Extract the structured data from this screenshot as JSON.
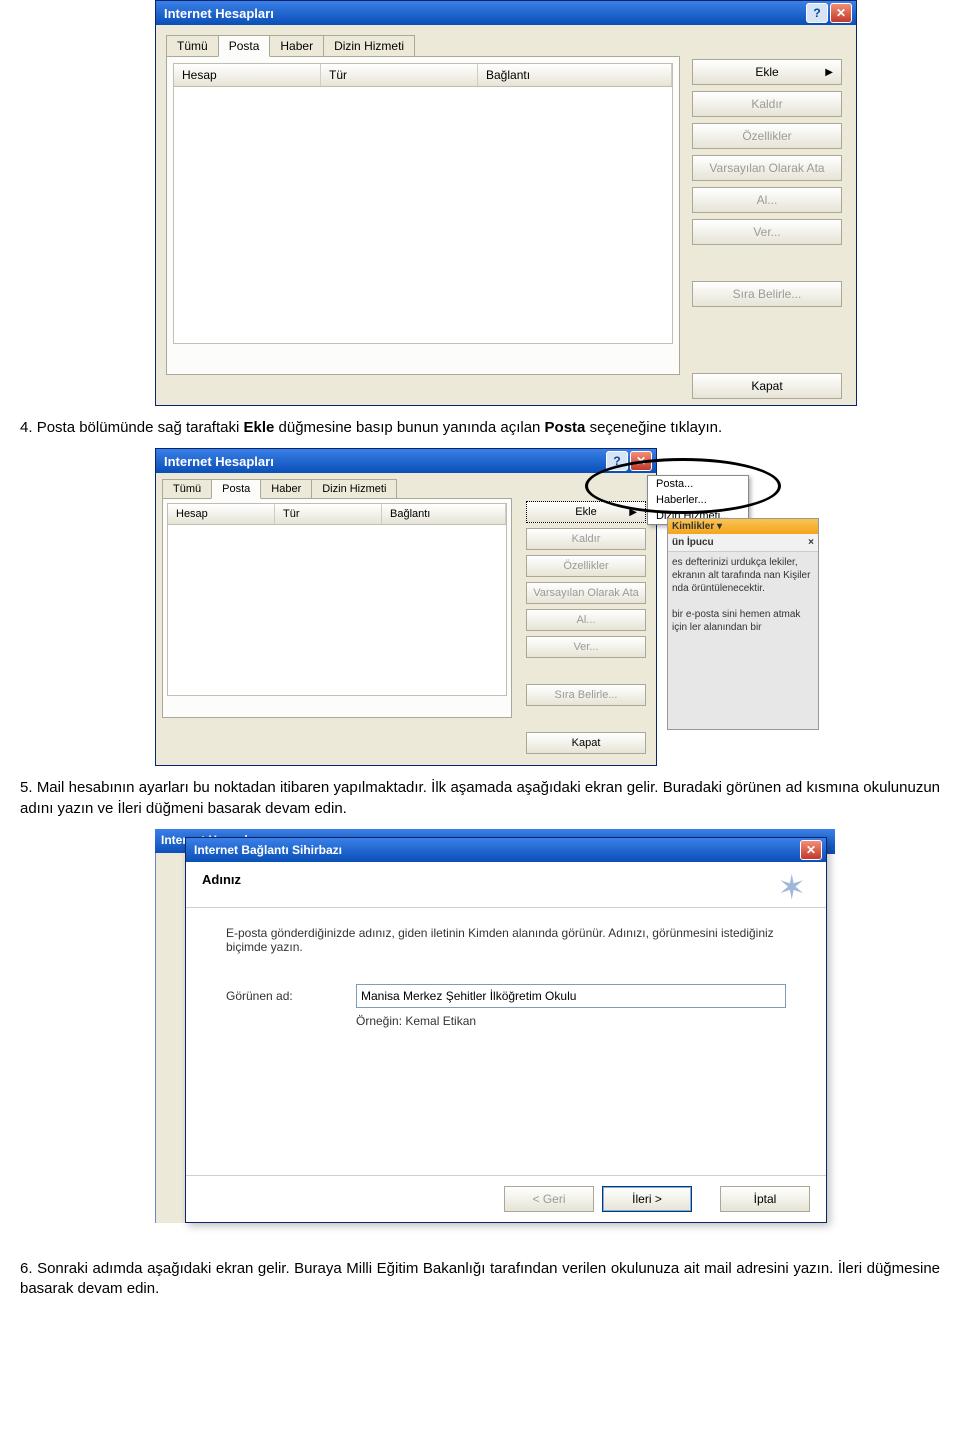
{
  "dlg1": {
    "title": "Internet Hesapları",
    "tabs": [
      "Tümü",
      "Posta",
      "Haber",
      "Dizin Hizmeti"
    ],
    "activeTab": 1,
    "columns": [
      "Hesap",
      "Tür",
      "Bağlantı"
    ],
    "buttons": {
      "ekle": "Ekle",
      "kaldir": "Kaldır",
      "ozellikler": "Özellikler",
      "varsayilan": "Varsayılan Olarak Ata",
      "al": "Al...",
      "ver": "Ver...",
      "sira": "Sıra Belirle...",
      "kapat": "Kapat"
    }
  },
  "instr4": {
    "num": "4.",
    "p1": "Posta bölümünde sağ taraftaki ",
    "b1": "Ekle",
    "p2": " düğmesine basıp bunun yanında açılan ",
    "b2": "Posta",
    "p3": " seçeneğine tıklayın."
  },
  "dlg2": {
    "title": "Internet Hesapları",
    "tabs": [
      "Tümü",
      "Posta",
      "Haber",
      "Dizin Hizmeti"
    ],
    "columns": [
      "Hesap",
      "Tür",
      "Bağlantı"
    ],
    "buttons": {
      "ekle": "Ekle",
      "kaldir": "Kaldır",
      "ozellikler": "Özellikler",
      "varsayilan": "Varsayılan Olarak Ata",
      "al": "Al...",
      "ver": "Ver...",
      "sira": "Sıra Belirle...",
      "kapat": "Kapat"
    },
    "popup": [
      "Posta...",
      "Haberler...",
      "Dizin Hizmeti..."
    ],
    "side": {
      "hdr": "Kimlikler ▾",
      "tip_title": "ün İpucu",
      "tip_close": "×",
      "tip_body": "es defterinizi urdukça lekiler, ekranın alt tarafında nan Kişiler nda örüntülenecektir.",
      "tip_body2": "bir e-posta sini hemen atmak için ler alanından bir"
    }
  },
  "instr5": {
    "num": "5.",
    "text": "Mail hesabının ayarları bu noktadan itibaren yapılmaktadır. İlk aşamada aşağıdaki ekran gelir. Buradaki görünen ad kısmına okulunuzun adını yazın ve İleri düğmeni basarak devam edin."
  },
  "wiz": {
    "bgtitle": "Internet Hesapları",
    "title": "Internet Bağlantı Sihirbazı",
    "heading": "Adınız",
    "desc": "E-posta gönderdiğinizde adınız, giden iletinin Kimden alanında görünür. Adınızı, görünmesini istediğiniz biçimde yazın.",
    "label": "Görünen ad:",
    "value": "Manisa Merkez Şehitler İlköğretim Okulu",
    "example": "Örneğin: Kemal Etikan",
    "buttons": {
      "geri": "< Geri",
      "ileri": "İleri >",
      "iptal": "İptal"
    }
  },
  "instr6": {
    "num": "6.",
    "text": "Sonraki adımda aşağıdaki ekran gelir. Buraya Milli Eğitim Bakanlığı tarafından verilen okulunuza ait mail adresini yazın. İleri düğmesine basarak devam edin."
  }
}
